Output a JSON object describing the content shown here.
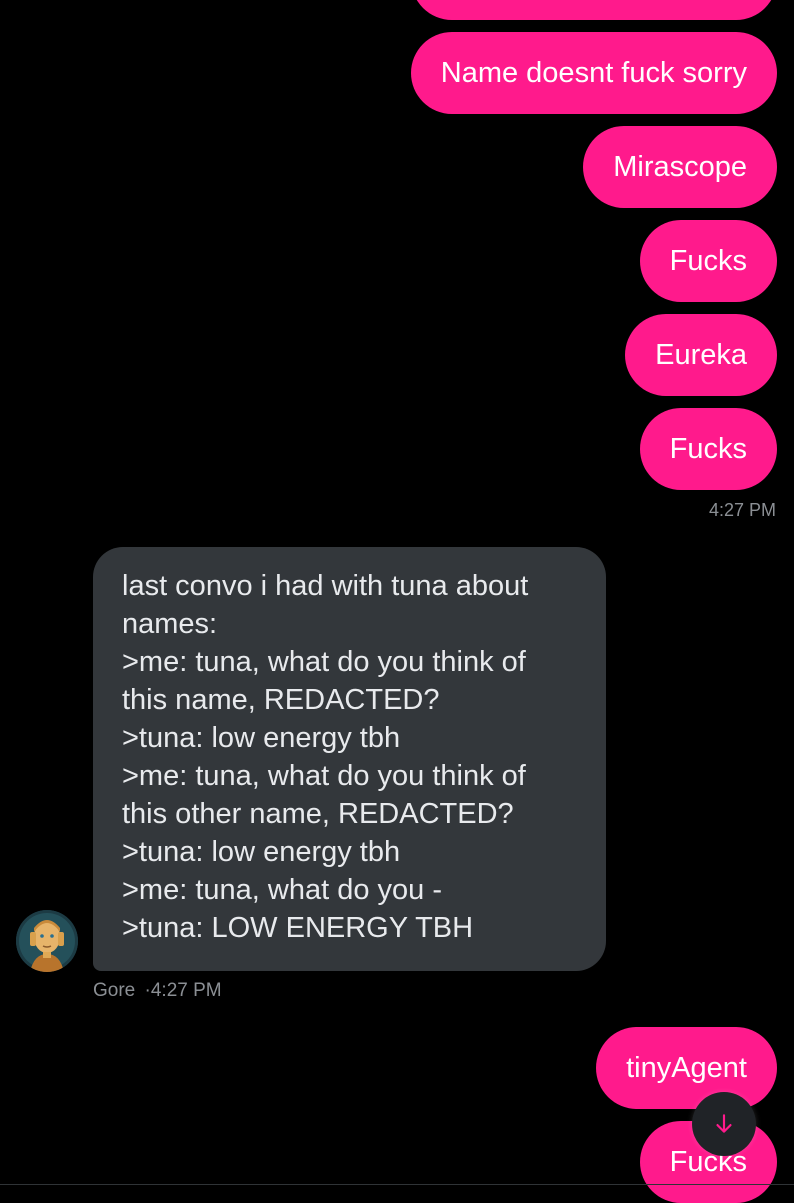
{
  "outgoing_group_1": [
    {
      "text": ""
    },
    {
      "text": "Name doesnt fuck sorry"
    },
    {
      "text": "Mirascope"
    },
    {
      "text": "Fucks"
    },
    {
      "text": "Eureka"
    },
    {
      "text": "Fucks"
    }
  ],
  "outgoing_timestamp": "4:27 PM",
  "incoming": {
    "lines": [
      "last convo i had with tuna about",
      "names:",
      ">me: tuna, what do you think of",
      "this name, REDACTED?",
      ">tuna: low energy tbh",
      ">me: tuna, what do you think of",
      "this other name, REDACTED?",
      ">tuna: low energy tbh",
      ">me: tuna, what do you -",
      ">tuna: LOW ENERGY TBH"
    ],
    "sender": "Gore",
    "separator": "·",
    "time": "4:27 PM"
  },
  "outgoing_group_2": [
    {
      "text": "tinyAgent"
    },
    {
      "text": "Fucks"
    }
  ],
  "colors": {
    "outgoing_bubble": "#ff1a8c",
    "incoming_bubble": "#33373b",
    "background": "#000000",
    "meta_text": "#8b8f94"
  },
  "icons": {
    "scroll_down": "arrow-down-icon",
    "avatar": "avatar-image"
  }
}
